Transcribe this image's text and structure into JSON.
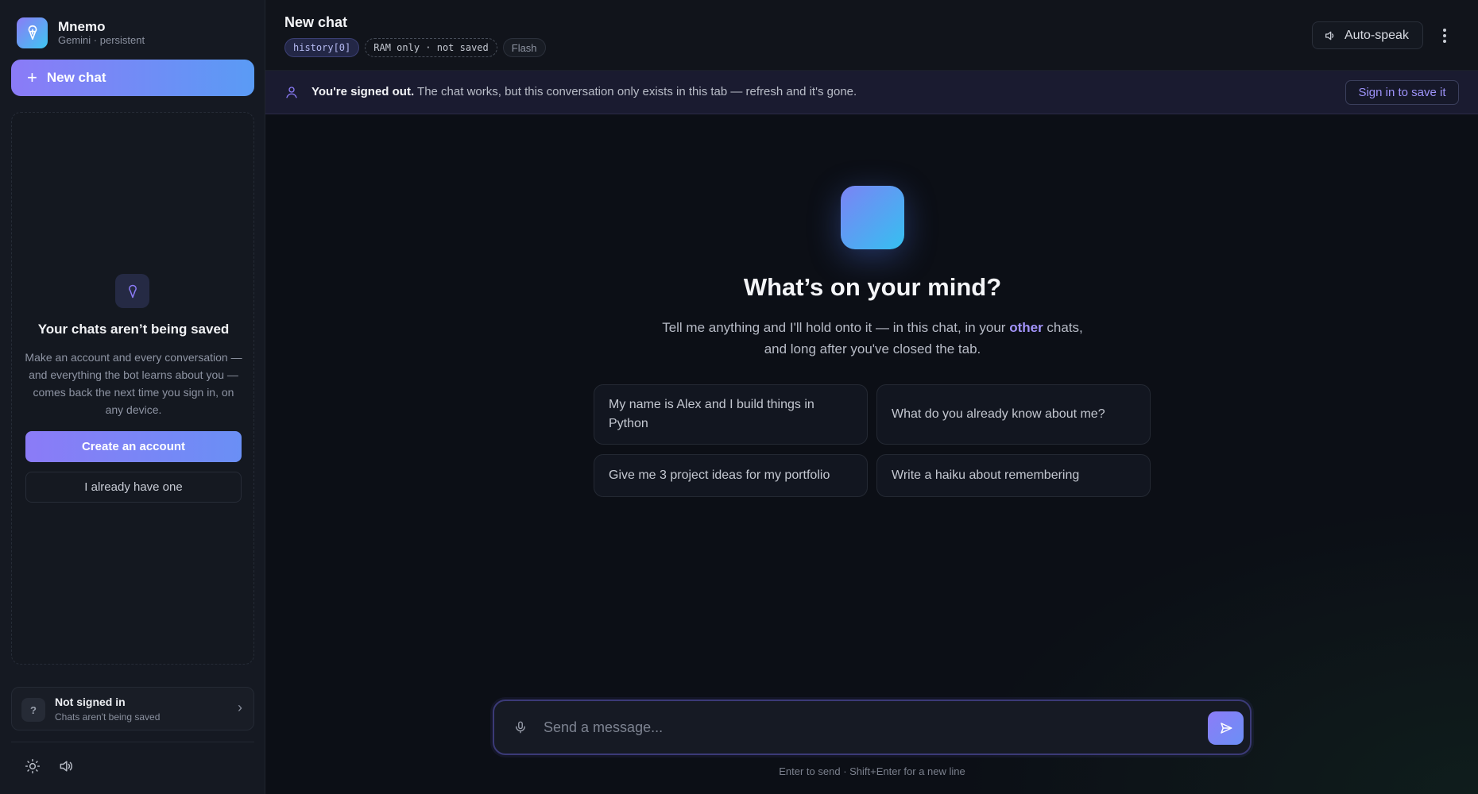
{
  "brand": {
    "name": "Mnemo",
    "subtitle": "Gemini · persistent"
  },
  "sidebar": {
    "new_chat_label": "New chat",
    "empty": {
      "title": "Your chats aren’t being saved",
      "text": "Make an account and every conversation — and everything the bot learns about you — comes back the next time you sign in, on any device.",
      "create_label": "Create an account",
      "have_label": "I already have one"
    },
    "account": {
      "title": "Not signed in",
      "subtitle": "Chats aren't being saved",
      "badge": "?"
    },
    "tools": [
      "sun-icon",
      "speaker-icon"
    ]
  },
  "header": {
    "title": "New chat",
    "chips": {
      "history": "history[0]",
      "ram": "RAM only · not saved",
      "model": "Flash"
    },
    "autospeak_label": "Auto-speak"
  },
  "banner": {
    "bold": "You're signed out.",
    "text": " The chat works, but this conversation only exists in this tab — refresh and it's gone.",
    "button": "Sign in to save it"
  },
  "hero": {
    "title": "What’s on your mind?",
    "sub_before": "Tell me anything and I'll hold onto it — in this chat, in your ",
    "sub_accent": "other",
    "sub_after": " chats, and long after you've closed the tab."
  },
  "suggestions": [
    "My name is Alex and I build things in Python",
    "What do you already know about me?",
    "Give me 3 project ideas for my portfolio",
    "Write a haiku about remembering"
  ],
  "composer": {
    "placeholder": "Send a message...",
    "hint": "Enter to send · Shift+Enter for a new line"
  },
  "colors": {
    "accent": "#8b7bf7",
    "accent_blue": "#3ec6f2",
    "background": "#0d1017",
    "sidebar": "#151922"
  }
}
